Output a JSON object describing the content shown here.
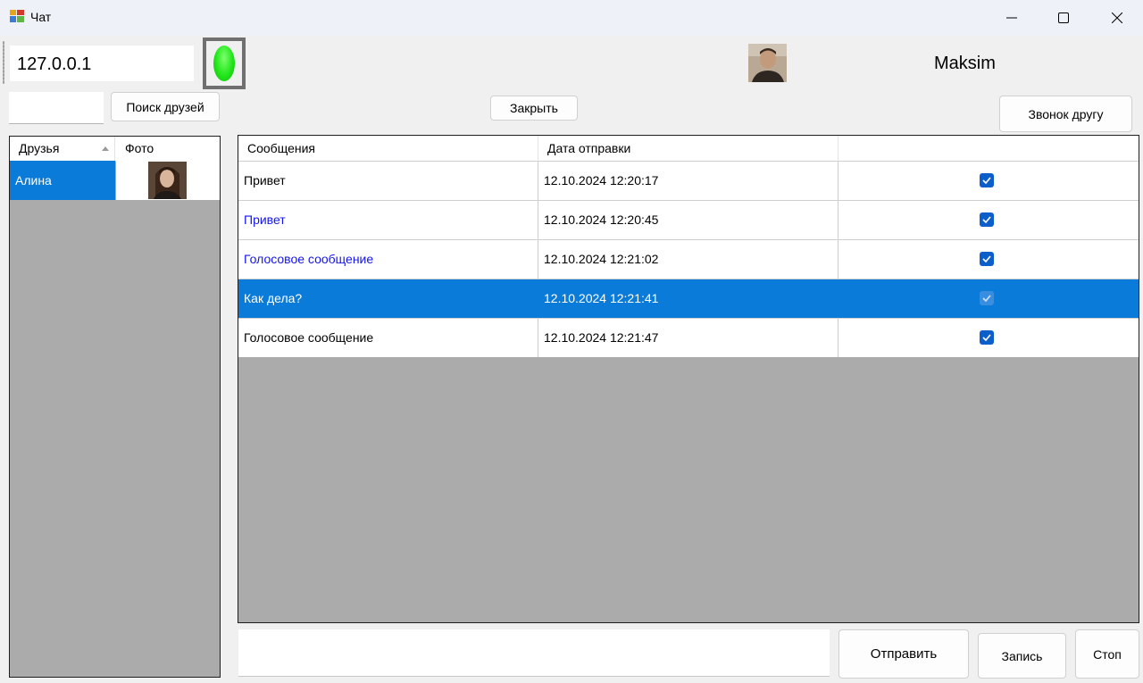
{
  "window": {
    "title": "Чат",
    "controls": [
      "minimize-icon",
      "maximize-icon",
      "close-icon"
    ]
  },
  "toolbar": {
    "ip_value": "127.0.0.1",
    "connection_status_color": "#22e61a",
    "username": "Maksim",
    "search_value": "",
    "find_friends_label": "Поиск друзей",
    "close_label": "Закрыть",
    "call_friend_label": "Звонок другу"
  },
  "friends": {
    "columns": [
      "Друзья",
      "Фото"
    ],
    "sort_indicator": "sort-ascending-icon",
    "rows": [
      {
        "name": "Алина",
        "selected": true
      }
    ]
  },
  "messages": {
    "columns": [
      "Сообщения",
      "Дата отправки",
      ""
    ],
    "rows": [
      {
        "text": "Привет",
        "date": "12.10.2024 12:20:17",
        "checked": true,
        "style": "normal",
        "selected": false
      },
      {
        "text": "Привет",
        "date": "12.10.2024 12:20:45",
        "checked": true,
        "style": "blue",
        "selected": false
      },
      {
        "text": "Голосовое сообщение",
        "date": "12.10.2024 12:21:02",
        "checked": true,
        "style": "blue",
        "selected": false
      },
      {
        "text": "Как дела?",
        "date": "12.10.2024 12:21:41",
        "checked": true,
        "style": "normal",
        "selected": true
      },
      {
        "text": "Голосовое сообщение",
        "date": "12.10.2024 12:21:47",
        "checked": true,
        "style": "normal",
        "selected": false
      }
    ]
  },
  "compose": {
    "input_value": "",
    "send_label": "Отправить",
    "record_label": "Запись",
    "stop_label": "Стоп"
  },
  "colors": {
    "selection": "#0a7bd9",
    "blue_text": "#1515ee",
    "grid_background": "#ababab"
  }
}
